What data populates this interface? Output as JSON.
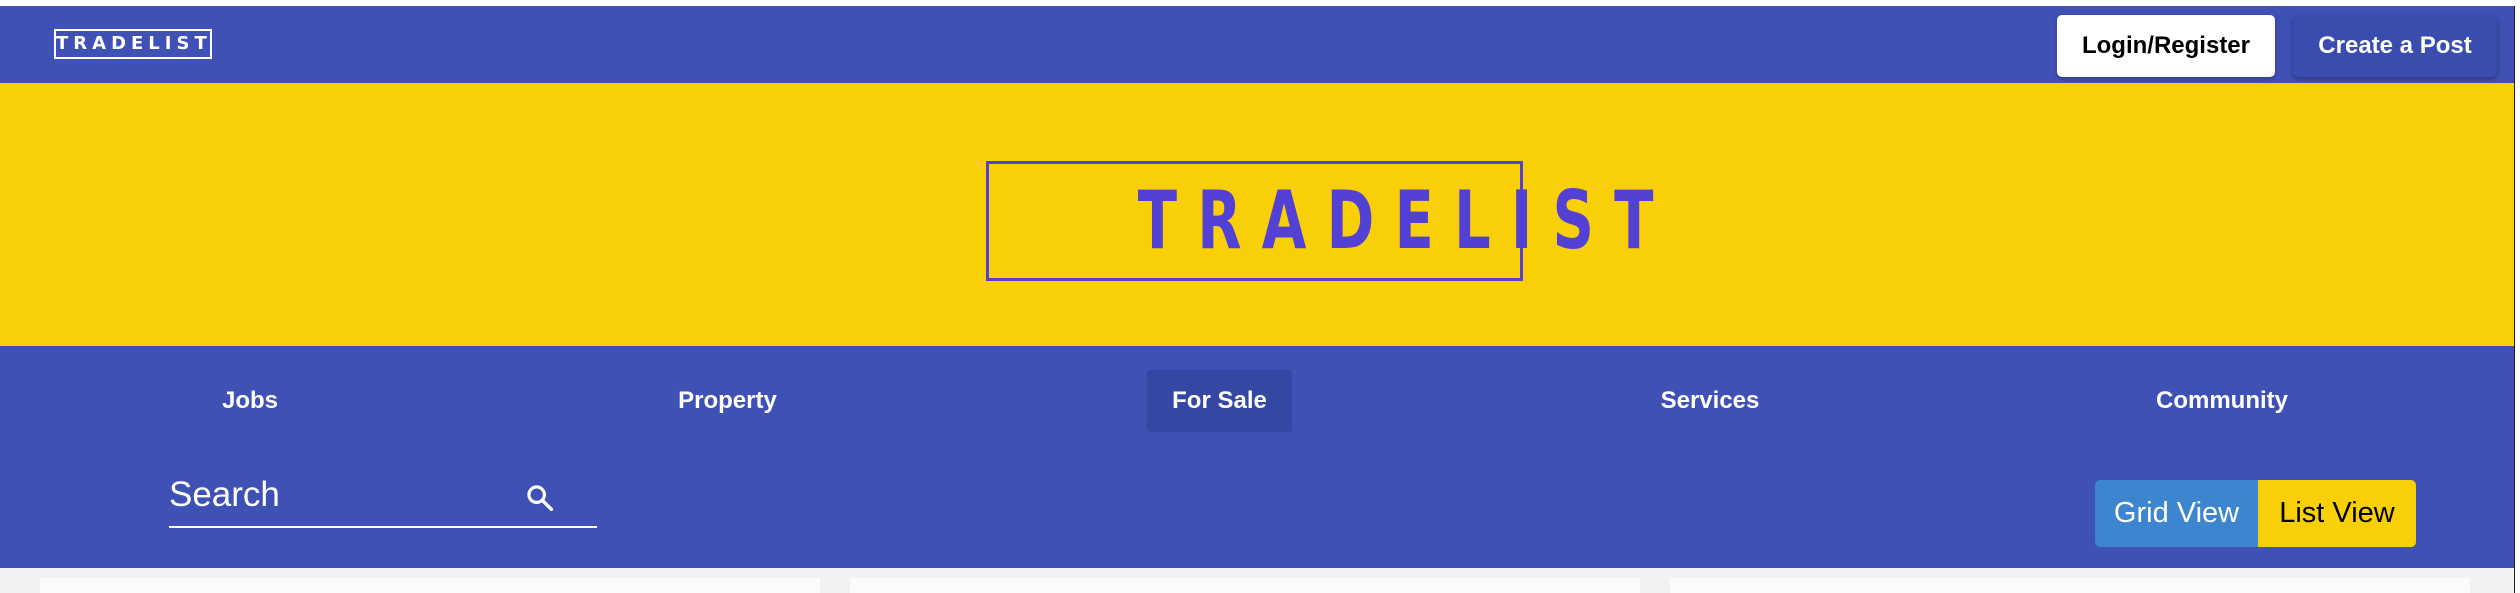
{
  "header": {
    "logo_text": "TRADELIST",
    "login_label": "Login/Register",
    "create_label": "Create a Post"
  },
  "hero": {
    "logo_text": "TRADELIST"
  },
  "nav": {
    "items": [
      {
        "label": "Jobs",
        "active": false
      },
      {
        "label": "Property",
        "active": false
      },
      {
        "label": "For Sale",
        "active": true
      },
      {
        "label": "Services",
        "active": false
      },
      {
        "label": "Community",
        "active": false
      }
    ]
  },
  "search": {
    "placeholder": "Search",
    "icon": "search-icon"
  },
  "view_toggle": {
    "grid_label": "Grid View",
    "list_label": "List View",
    "selected": "List View"
  },
  "colors": {
    "primary": "#3f51b5",
    "accent": "#f9cf07",
    "logo_purple": "#5341d6",
    "grid_blue": "#3d86cf"
  }
}
